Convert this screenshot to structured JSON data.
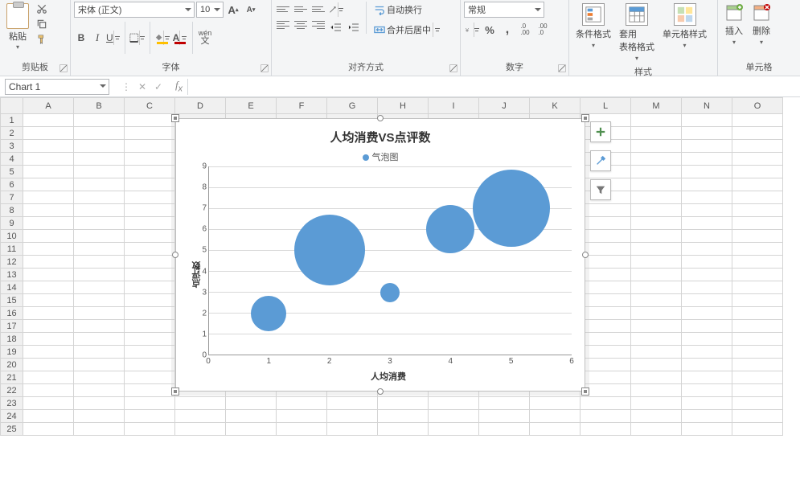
{
  "ribbon": {
    "clipboard": {
      "label": "剪贴板",
      "paste": "粘贴"
    },
    "font": {
      "label": "字体",
      "name": "宋体 (正文)",
      "size": "10",
      "bold": "B",
      "italic": "I",
      "underline": "U",
      "phonetic": "wén"
    },
    "alignment": {
      "label": "对齐方式",
      "wrap": "自动换行",
      "merge": "合并后居中"
    },
    "number": {
      "label": "数字",
      "format": "常规"
    },
    "styles": {
      "label": "样式",
      "conditional": "条件格式",
      "table": "套用\n表格格式",
      "cell": "单元格样式"
    },
    "cells": {
      "label": "单元格",
      "insert": "插入",
      "delete": "删除"
    }
  },
  "formula_bar": {
    "name_box": "Chart 1"
  },
  "columns": [
    "A",
    "B",
    "C",
    "D",
    "E",
    "F",
    "G",
    "H",
    "I",
    "J",
    "K",
    "L",
    "M",
    "N",
    "O"
  ],
  "rows": 25,
  "chart_tools": {
    "add": "chart-add",
    "brush": "chart-style",
    "filter": "chart-filter"
  },
  "chart_data": {
    "type": "bubble",
    "title": "人均消费VS点评数",
    "legend": "气泡图",
    "xlabel": "人均消费",
    "ylabel": "点评数",
    "xlim": [
      0,
      6
    ],
    "ylim": [
      0,
      9
    ],
    "yticks": [
      0,
      1,
      2,
      3,
      4,
      5,
      6,
      7,
      8,
      9
    ],
    "xticks": [
      0,
      1,
      2,
      3,
      4,
      5,
      6
    ],
    "points": [
      {
        "x": 1,
        "y": 2,
        "r": 22
      },
      {
        "x": 2,
        "y": 5,
        "r": 44
      },
      {
        "x": 3,
        "y": 3,
        "r": 12
      },
      {
        "x": 4,
        "y": 6,
        "r": 30
      },
      {
        "x": 5,
        "y": 7,
        "r": 48
      }
    ]
  }
}
